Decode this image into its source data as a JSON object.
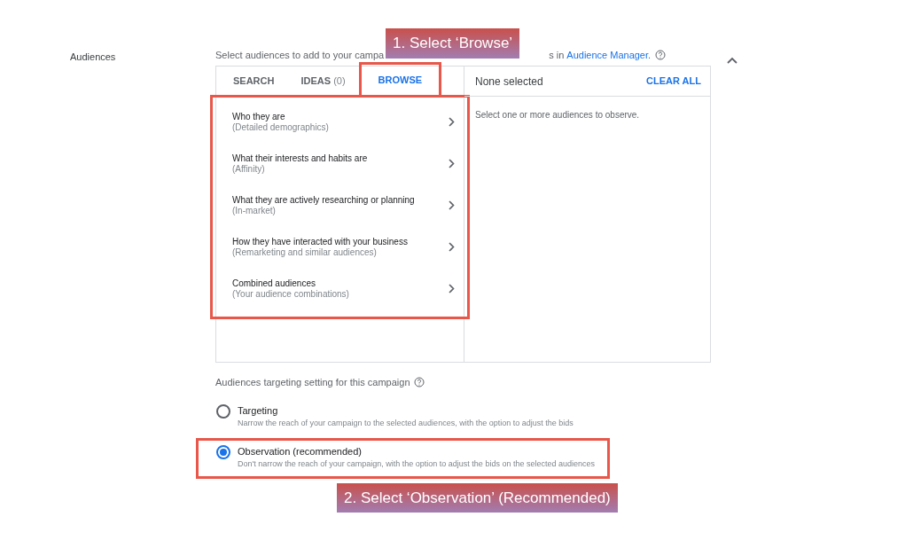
{
  "section": {
    "label": "Audiences",
    "intro_start": "Select audiences to add to your campa",
    "intro_end": "s in",
    "intro_link": "Audience Manager.",
    "expanded": true
  },
  "callouts": [
    "1.  Select ‘Browse’",
    "2. Select ‘Observation’ (Recommended)"
  ],
  "tabs": [
    {
      "label": "SEARCH",
      "selected": false,
      "highlighted": false
    },
    {
      "label": "IDEAS",
      "count": "(0)",
      "selected": false,
      "highlighted": false
    },
    {
      "label": "BROWSE",
      "selected": true,
      "highlighted": true
    }
  ],
  "browse": {
    "highlighted": true,
    "categories": [
      {
        "title": "Who they are",
        "subtitle": "(Detailed demographics)"
      },
      {
        "title": "What their interests and habits are",
        "subtitle": "(Affinity)"
      },
      {
        "title": "What they are actively researching or planning",
        "subtitle": "(In-market)"
      },
      {
        "title": "How they have interacted with your business",
        "subtitle": "(Remarketing and similar audiences)"
      },
      {
        "title": "Combined audiences",
        "subtitle": "(Your audience combinations)"
      }
    ]
  },
  "selection": {
    "status": "None selected",
    "clear_button": "CLEAR ALL",
    "empty_message": "Select one or more audiences to observe."
  },
  "targeting": {
    "label": "Audiences targeting setting for this campaign",
    "options": [
      {
        "label": "Targeting",
        "description": "Narrow the reach of your campaign to the selected audiences, with the option to adjust the bids",
        "selected": false,
        "highlighted": false
      },
      {
        "label": "Observation (recommended)",
        "description": "Don't narrow the reach of your campaign, with the option to adjust the bids on the selected audiences",
        "selected": true,
        "highlighted": true
      }
    ]
  }
}
